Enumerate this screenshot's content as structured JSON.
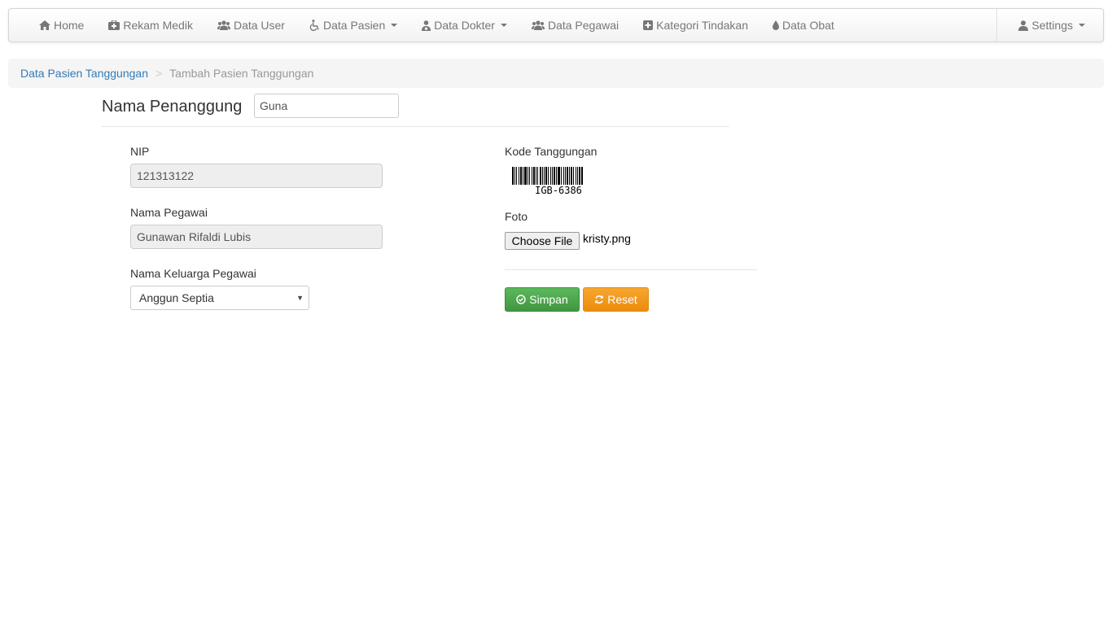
{
  "navbar": {
    "items": [
      {
        "label": "Home",
        "icon": "home-icon"
      },
      {
        "label": "Rekam Medik",
        "icon": "medkit-icon"
      },
      {
        "label": "Data User",
        "icon": "users-icon"
      },
      {
        "label": "Data Pasien",
        "icon": "wheelchair-icon",
        "dropdown": true
      },
      {
        "label": "Data Dokter",
        "icon": "user-md-icon",
        "dropdown": true
      },
      {
        "label": "Data Pegawai",
        "icon": "users-icon"
      },
      {
        "label": "Kategori Tindakan",
        "icon": "plus-square-icon"
      },
      {
        "label": "Data Obat",
        "icon": "tint-icon"
      }
    ],
    "settings": {
      "label": "Settings",
      "icon": "user-icon"
    }
  },
  "breadcrumb": {
    "parent": "Data Pasien Tanggungan",
    "separator": ">",
    "current": "Tambah Pasien Tanggungan"
  },
  "header": {
    "label": "Nama Penanggung",
    "input_value": "Guna"
  },
  "form": {
    "nip_label": "NIP",
    "nip_value": "121313122",
    "nama_pegawai_label": "Nama Pegawai",
    "nama_pegawai_value": "Gunawan Rifaldi Lubis",
    "keluarga_label": "Nama Keluarga Pegawai",
    "keluarga_selected": "Anggun Septia",
    "kode_label": "Kode Tanggungan",
    "kode_value": "IGB-6386",
    "foto_label": "Foto",
    "choose_file_label": "Choose File",
    "file_name": "kristy.png",
    "save_label": "Simpan",
    "reset_label": "Reset"
  },
  "colors": {
    "link": "#337ab7",
    "save": "#5cb85c",
    "reset": "#f0ad4e"
  }
}
